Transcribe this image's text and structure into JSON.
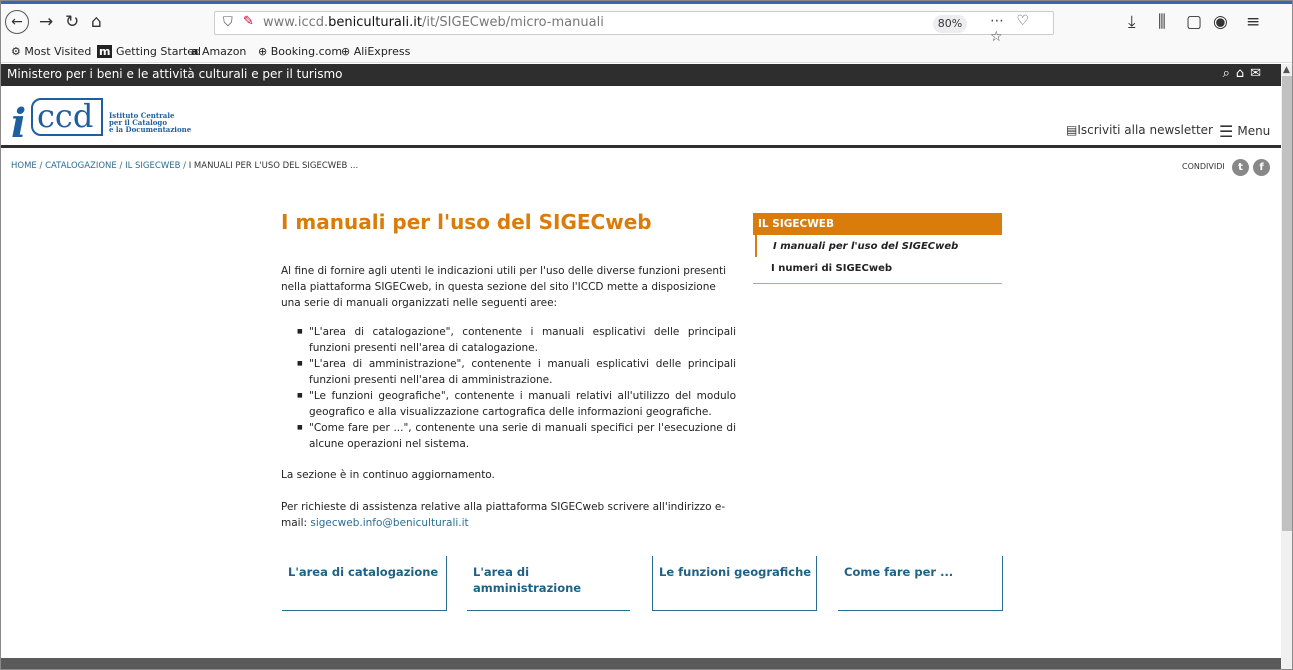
{
  "browser": {
    "url_prefix": "www.iccd.",
    "url_domain": "beniculturali.it",
    "url_path": "/it/SIGECweb/micro-manuali",
    "zoom": "80%",
    "url_actions": "⋯ ♡ ☆",
    "bookmarks": [
      "Most Visited",
      "Getting Started",
      "Amazon",
      "Booking.com",
      "AliExpress"
    ]
  },
  "site": {
    "ministero": "Ministero per i beni e le attività culturali e per il turismo",
    "logo_i": "i",
    "logo_ccd": "ccd",
    "logo_line1": "Istituto Centrale",
    "logo_line2": "per il Catalogo",
    "logo_line3": "e la Documentazione",
    "newsletter": "Iscriviti alla newsletter",
    "menu": "Menu",
    "condividi": "CONDIVIDI"
  },
  "breadcrumb": {
    "home": "HOME",
    "catalogazione": "CATALOGAZIONE",
    "sigecweb": "IL SIGECWEB",
    "current": "I MANUALI PER L'USO DEL SIGECWEB ..."
  },
  "main": {
    "title": "I manuali per l'uso del SIGECweb",
    "intro": "Al fine di fornire agli utenti le indicazioni utili per l'uso delle diverse funzioni presenti nella piattaforma SIGECweb, in questa sezione del sito l'ICCD mette a disposizione una serie di manuali organizzati nelle seguenti aree:",
    "bullets": [
      "\"L'area di catalogazione\", contenente i manuali esplicativi delle principali funzioni presenti nell'area di catalogazione.",
      "\"L'area di amministrazione\", contenente i manuali esplicativi delle principali funzioni presenti nell'area di amministrazione.",
      "\"Le funzioni geografiche\", contenente i manuali relativi all'utilizzo del modulo geografico e alla visualizzazione cartografica delle informazioni geografiche.",
      "\"Come fare per ...\", contenente una serie di manuali specifici per l'esecuzione di alcune operazioni nel sistema."
    ],
    "aggiornamento": "La sezione è in continuo aggiornamento.",
    "assistenza": "Per richieste di assistenza relative alla piattaforma SIGECweb scrivere all'indirizzo e-mail: ",
    "email": "sigecweb.info@beniculturali.it"
  },
  "sidebar": {
    "heading": "IL SIGECWEB",
    "items": [
      "I manuali per l'uso del SIGECweb",
      "I numeri di SIGECweb"
    ]
  },
  "cards": [
    "L'area di catalogazione",
    "L'area di amministrazione",
    "Le funzioni geografiche",
    "Come fare per ..."
  ]
}
